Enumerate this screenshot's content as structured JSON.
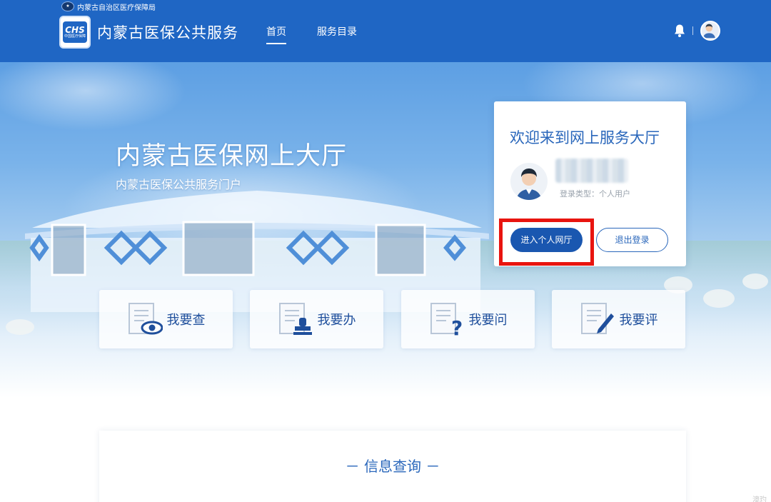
{
  "header": {
    "gov_name": "内蒙古自治区医疗保障局",
    "logo_text": "CHS",
    "logo_subtext": "中国医疗保障",
    "site_title": "内蒙古医保公共服务",
    "nav": [
      {
        "label": "首页",
        "active": true
      },
      {
        "label": "服务目录",
        "active": false
      }
    ],
    "divider": "|"
  },
  "hero": {
    "title": "内蒙古医保网上大厅",
    "subtitle": "内蒙古医保公共服务门户"
  },
  "login_card": {
    "welcome": "欢迎来到网上服务大厅",
    "login_type": "登录类型：个人用户",
    "enter_button": "进入个人网厅",
    "logout_button": "退出登录",
    "highlight_color": "#e8140f"
  },
  "services": [
    {
      "label": "我要查",
      "icon": "doc-eye-icon"
    },
    {
      "label": "我要办",
      "icon": "doc-stamp-icon"
    },
    {
      "label": "我要问",
      "icon": "doc-question-icon"
    },
    {
      "label": "我要评",
      "icon": "doc-pen-icon"
    }
  ],
  "info_section": {
    "title": "－ 信息查询 －"
  },
  "colors": {
    "brand_blue": "#1f66c4",
    "button_blue": "#1a57b0",
    "text_blue": "#2a67bb"
  },
  "watermark": "澳玓"
}
